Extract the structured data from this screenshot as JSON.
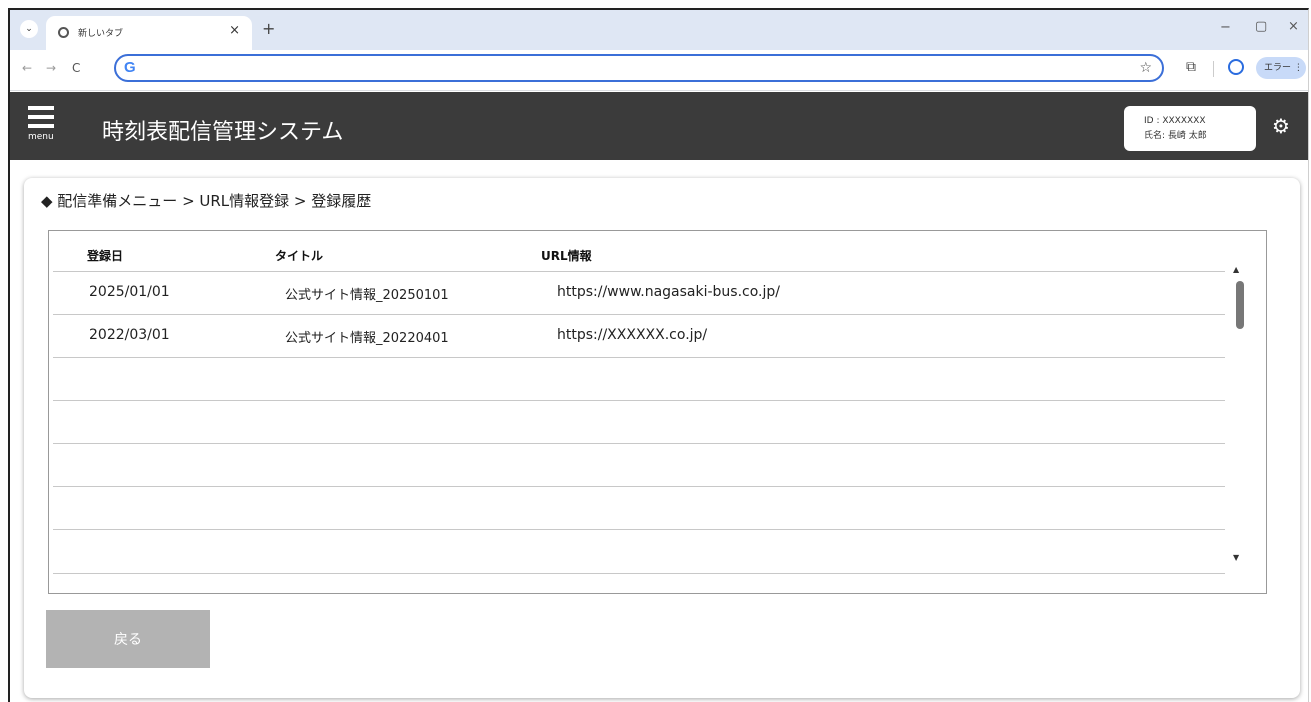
{
  "browser": {
    "tab_title": "新しいタブ",
    "close_glyph": "×",
    "newtab_glyph": "+",
    "dropdown_glyph": "⌄",
    "min_glyph": "−",
    "restore_glyph": "▢",
    "winclose_glyph": "×",
    "back_glyph": "←",
    "forward_glyph": "→",
    "reload_glyph": "C",
    "address_value": "",
    "google_glyph": "G",
    "star_glyph": "☆",
    "extension_glyph": "⧉",
    "error_label": "エラー ⋮"
  },
  "app": {
    "menu_label": "menu",
    "title": "時刻表配信管理システム",
    "user_id": "ID : XXXXXXX",
    "user_name": "氏名: 長崎 太郎",
    "gear_glyph": "⚙"
  },
  "breadcrumb": "◆ 配信準備メニュー > URL情報登録 > 登録履歴",
  "table": {
    "headers": {
      "date": "登録日",
      "title": "タイトル",
      "url": "URL情報"
    },
    "rows": [
      {
        "date": "2025/01/01",
        "title": "公式サイト情報_20250101",
        "url": "https://www.nagasaki-bus.co.jp/"
      },
      {
        "date": "2022/03/01",
        "title": "公式サイト情報_20220401",
        "url": "https://XXXXXX.co.jp/"
      },
      {
        "date": "",
        "title": "",
        "url": ""
      },
      {
        "date": "",
        "title": "",
        "url": ""
      },
      {
        "date": "",
        "title": "",
        "url": ""
      },
      {
        "date": "",
        "title": "",
        "url": ""
      },
      {
        "date": "",
        "title": "",
        "url": ""
      }
    ],
    "scroll_up": "▲",
    "scroll_down": "▼"
  },
  "actions": {
    "back_label": "戻る"
  },
  "colors": {
    "header_bg": "#3b3b3b",
    "button_bg": "#b3b3b3",
    "address_border": "#3b6fd8"
  }
}
